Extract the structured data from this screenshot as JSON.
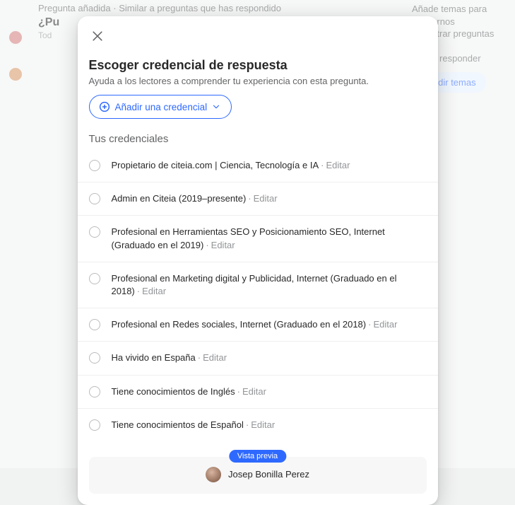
{
  "background": {
    "right": {
      "line1": "Añade temas para ayudarnos",
      "line2": "encontrar preguntas que",
      "line3": "uedas responder",
      "btn": "Añadir temas"
    },
    "left": {
      "added": "Pregunta añadida · Similar a preguntas que has respondido",
      "pu": "¿Pu",
      "tod": "Tod"
    }
  },
  "modal": {
    "title": "Escoger credencial de respuesta",
    "subtitle": "Ayuda a los lectores a comprender tu experiencia con esta pregunta.",
    "add_label": "Añadir una credencial",
    "section": "Tus credenciales",
    "edit": "Editar",
    "creds": [
      "Propietario de citeia.com | Ciencia, Tecnología e IA",
      "Admin en Citeia (2019–presente)",
      "Profesional en Herramientas SEO y Posicionamiento SEO, Internet (Graduado en el 2019)",
      "Profesional en Marketing digital y Publicidad, Internet (Graduado en el 2018)",
      "Profesional en Redes sociales, Internet (Graduado en el 2018)",
      "Ha vivido en España",
      "Tiene conocimientos de Inglés",
      "Tiene conocimientos de Español"
    ],
    "preview_label": "Vista previa",
    "user_name": "Josep Bonilla Perez"
  }
}
